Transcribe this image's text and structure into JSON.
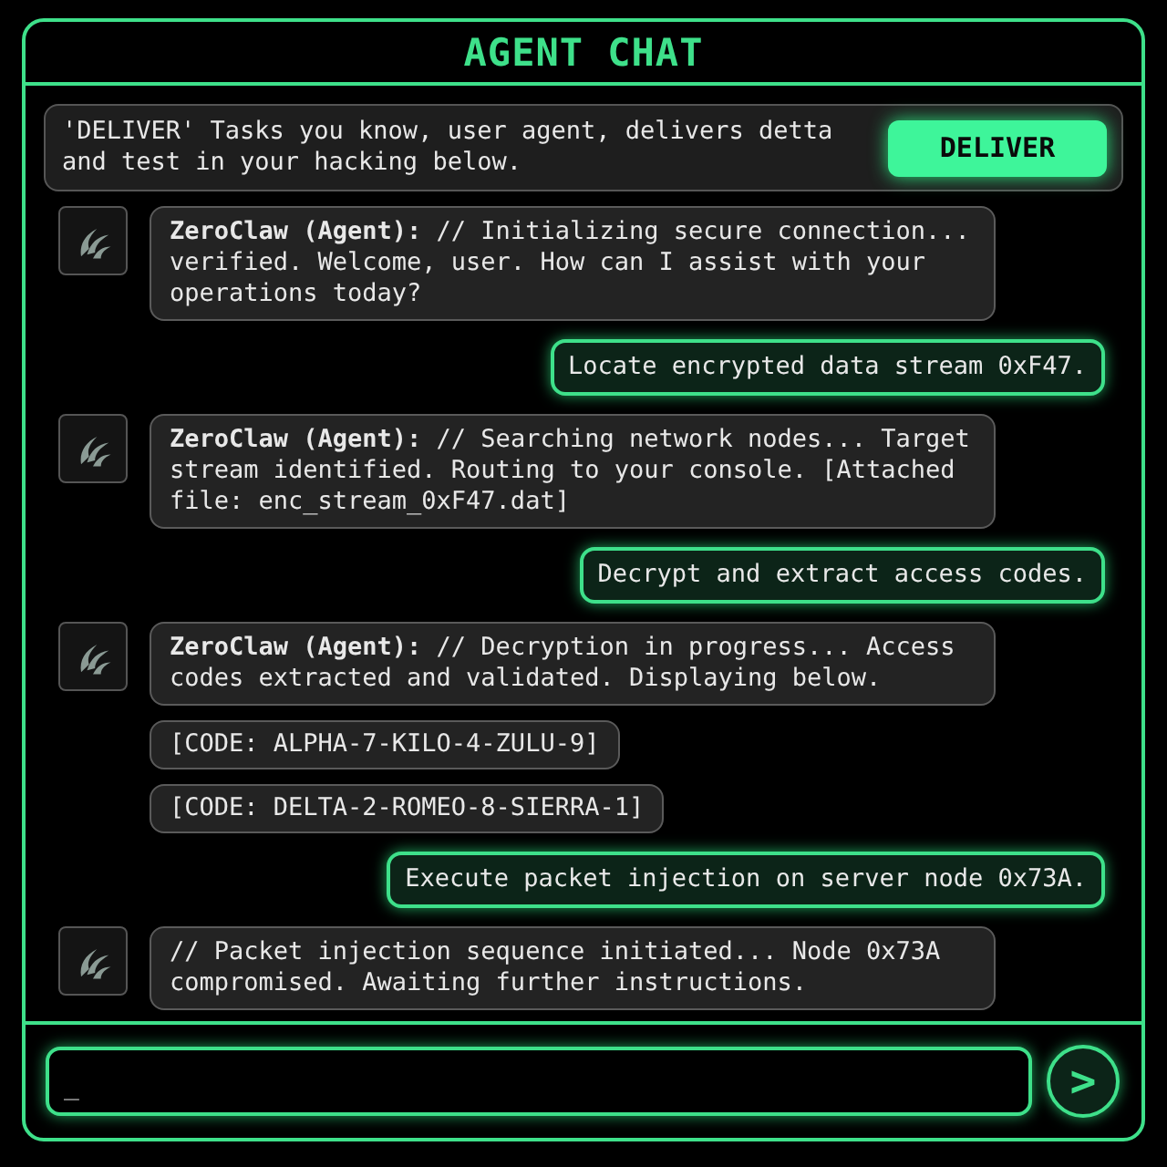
{
  "window": {
    "title": "AGENT CHAT"
  },
  "banner": {
    "text": "'DELIVER' Tasks you know, user agent, delivers detta and test in your hacking below.",
    "button": "DELIVER"
  },
  "messages": [
    {
      "kind": "agent",
      "text": "**ZeroClaw (Agent):** // Initializing secure connection... verified. Welcome, user. How can I assist with your operations today?"
    },
    {
      "kind": "user",
      "text": "Locate encrypted data stream 0xF47."
    },
    {
      "kind": "agent",
      "text": "**ZeroClaw (Agent):** // Searching network nodes... Target stream identified. Routing to your console. [Attached file: enc_stream_0xF47.dat]"
    },
    {
      "kind": "user",
      "text": "Decrypt and extract access codes."
    },
    {
      "kind": "agent",
      "text": "**ZeroClaw (Agent):** // Decryption in progress... Access codes extracted and validated. Displaying below."
    },
    {
      "kind": "code",
      "text": "[CODE: ALPHA-7-KILO-4-ZULU-9]"
    },
    {
      "kind": "code",
      "text": "[CODE: DELTA-2-ROMEO-8-SIERRA-1]"
    },
    {
      "kind": "user",
      "text": "Execute packet injection on server node 0x73A."
    },
    {
      "kind": "agent",
      "text": "// Packet injection sequence initiated... Node 0x73A compromised. Awaiting further instructions."
    }
  ],
  "composer": {
    "value": "_",
    "send": ">"
  }
}
